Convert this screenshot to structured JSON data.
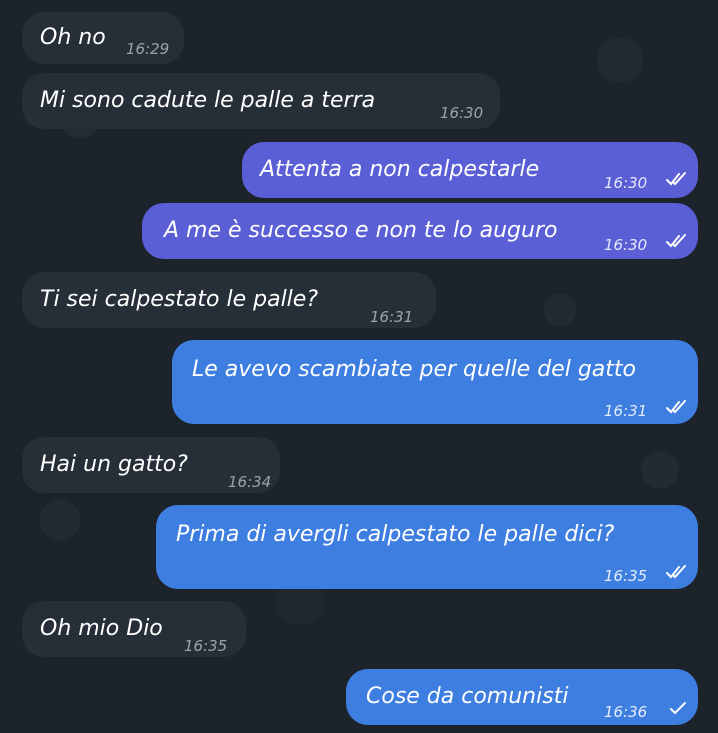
{
  "messages": [
    {
      "dir": "in",
      "text": "Oh no",
      "time": "16:29"
    },
    {
      "dir": "in",
      "text": "Mi sono cadute le palle a terra",
      "time": "16:30"
    },
    {
      "dir": "out",
      "text": "Attenta a non calpestarle",
      "time": "16:30",
      "status": "read"
    },
    {
      "dir": "out",
      "text": "A me è successo e non te lo auguro",
      "time": "16:30",
      "status": "read"
    },
    {
      "dir": "in",
      "text": "Ti sei calpestato le palle?",
      "time": "16:31"
    },
    {
      "dir": "out",
      "text": "Le avevo scambiate per quelle del gatto",
      "time": "16:31",
      "status": "read"
    },
    {
      "dir": "in",
      "text": "Hai un gatto?",
      "time": "16:34"
    },
    {
      "dir": "out",
      "text": "Prima di avergli calpestato le palle dici?",
      "time": "16:35",
      "status": "read"
    },
    {
      "dir": "in",
      "text": "Oh mio Dio",
      "time": "16:35"
    },
    {
      "dir": "out",
      "text": "Cose da comunisti",
      "time": "16:36",
      "status": "sent"
    }
  ],
  "colors": {
    "background": "#1c232a",
    "incoming_bubble": "#262f38",
    "outgoing_purple": "#5a5fd6",
    "outgoing_blue": "#3d7ee0"
  },
  "icons": {
    "read": "double-check-icon",
    "sent": "single-check-icon"
  }
}
